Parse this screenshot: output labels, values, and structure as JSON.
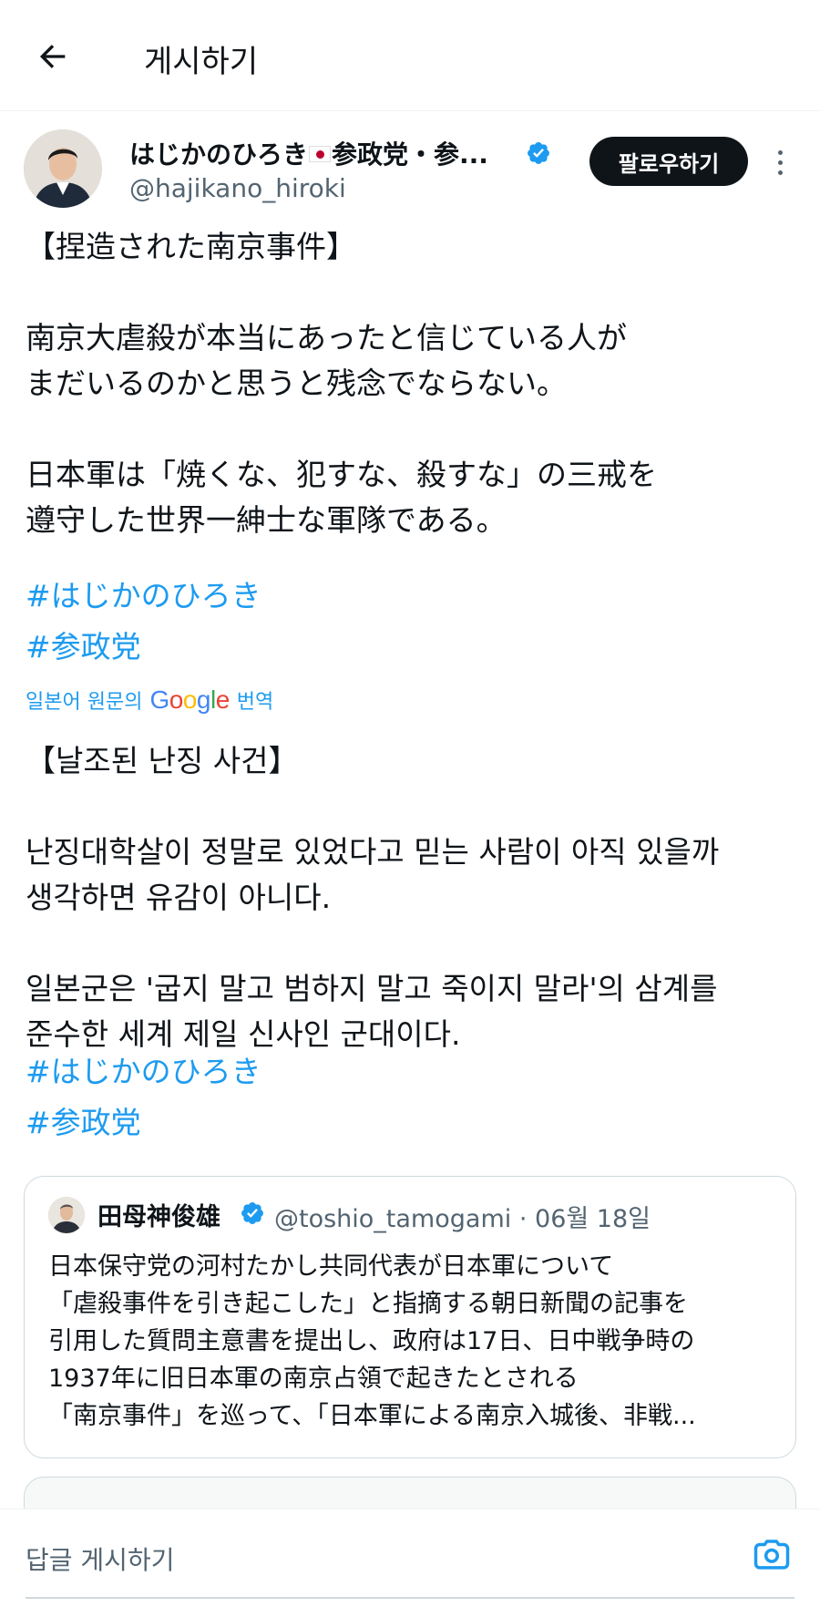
{
  "header": {
    "title": "게시하기",
    "back_icon": "arrow-left-icon"
  },
  "author": {
    "name": "はじかのひろき",
    "name_suffix": "参政党・参...",
    "flag_icon": "japan-flag-icon",
    "handle": "@hajikano_hiroki",
    "verified_icon": "verified-badge-icon",
    "follow_label": "팔로우하기",
    "more_icon": "more-vertical-icon"
  },
  "tweet": {
    "original_text": "【捏造された南京事件】\n\n南京大虐殺が本当にあったと信じている人が\nまだいるのかと思うと残念でならない。\n\n日本軍は「焼くな、犯すな、殺すな」の三戒を\n遵守した世界一紳士な軍隊である。",
    "original_hashtags": [
      "#はじかのひろき",
      "#参政党"
    ],
    "translate_prefix": "일본어 원문의",
    "translate_brand": "Google",
    "translate_suffix": "번역",
    "translated_text": "【날조된 난징 사건】\n\n난징대학살이 정말로 있었다고 믿는 사람이 아직 있을까\n생각하면 유감이 아니다.\n\n일본군은 '굽지 말고 범하지 말고 죽이지 말라'의 삼계를\n준수한 세계 제일 신사인 군대이다.",
    "translated_hashtags": [
      "#はじかのひろき",
      "#参政党"
    ]
  },
  "quote": {
    "name": "田母神俊雄",
    "handle": "@toshio_tamogami",
    "separator": "·",
    "date": "06월 18일",
    "text": "日本保守党の河村たかし共同代表が日本軍について\n「虐殺事件を引き起こした」と指摘する朝日新聞の記事を\n引用した質問主意書を提出し、政府は17日、日中戦争時の\n1937年に旧日本軍の南京占領で起きたとされる\n「南京事件」を巡って、「日本軍による南京入城後、非戦..."
  },
  "reply": {
    "placeholder": "답글 게시하기",
    "camera_icon": "camera-icon"
  },
  "colors": {
    "accent": "#1d9bf0",
    "text": "#0f1419",
    "secondary": "#536471",
    "follow_bg": "#0f1419"
  }
}
